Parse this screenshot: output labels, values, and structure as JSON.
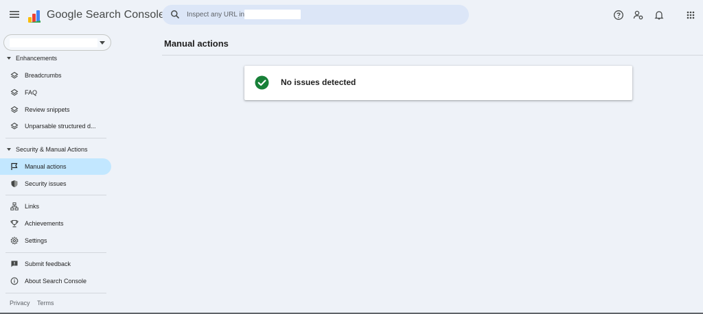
{
  "app": {
    "title": "Google Search Console"
  },
  "search": {
    "placeholder": "Inspect any URL in"
  },
  "top_icons": [
    "help-icon",
    "manage-users-icon",
    "notifications-icon",
    "apps-grid-icon"
  ],
  "sidebar": {
    "sections": [
      {
        "label": "Enhancements",
        "items": [
          {
            "label": "Breadcrumbs",
            "icon": "layers-icon"
          },
          {
            "label": "FAQ",
            "icon": "layers-icon"
          },
          {
            "label": "Review snippets",
            "icon": "layers-icon"
          },
          {
            "label": "Unparsable structured d...",
            "icon": "layers-icon"
          }
        ]
      },
      {
        "label": "Security & Manual Actions",
        "items": [
          {
            "label": "Manual actions",
            "icon": "flag-icon",
            "active": true
          },
          {
            "label": "Security issues",
            "icon": "shield-icon"
          }
        ]
      }
    ],
    "misc": [
      {
        "label": "Links",
        "icon": "links-icon"
      },
      {
        "label": "Achievements",
        "icon": "trophy-icon"
      },
      {
        "label": "Settings",
        "icon": "settings-icon"
      }
    ],
    "help": [
      {
        "label": "Submit feedback",
        "icon": "feedback-icon"
      },
      {
        "label": "About Search Console",
        "icon": "info-icon"
      }
    ],
    "footer": {
      "privacy": "Privacy",
      "terms": "Terms"
    }
  },
  "main": {
    "title": "Manual actions",
    "status": "No issues detected"
  },
  "colors": {
    "background": "#eef2f8",
    "active_nav": "#c2e7ff",
    "success": "#188038",
    "search_bg": "#dce6f7"
  }
}
